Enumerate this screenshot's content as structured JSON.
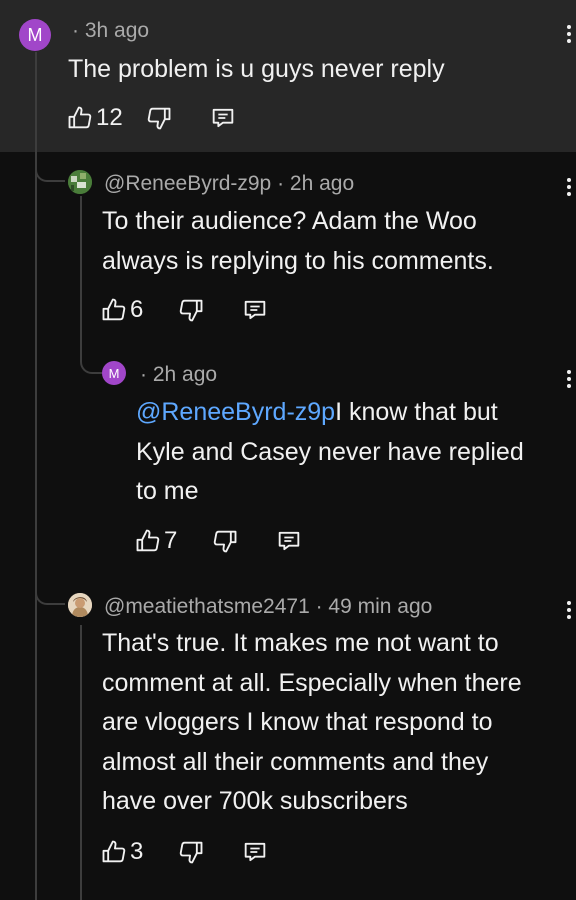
{
  "comments": [
    {
      "avatar_letter": "M",
      "avatar_color": "#a146c9",
      "meta": "· 3h ago",
      "lines": [
        "The problem is u guys never reply"
      ],
      "likes": "12"
    },
    {
      "avatar_icon": "pixel-art-avatar",
      "meta": "@ReneeByrd-z9p · 2h ago",
      "lines": [
        "To their audience? Adam the Woo",
        "always is replying to his comments."
      ],
      "likes": "6"
    },
    {
      "avatar_letter": "M",
      "avatar_color": "#a146c9",
      "meta": "· 2h ago",
      "mention": "@ReneeByrd-z9p",
      "lines": [
        "I know that but",
        "Kyle and Casey never have replied",
        "to me"
      ],
      "likes": "7"
    },
    {
      "avatar_icon": "photo-avatar",
      "meta": "@meatiethatsme2471 · 49 min ago",
      "lines": [
        "That's true. It makes me not want to",
        "comment at all. Especially when there",
        "are vloggers I know that respond to",
        "almost all their comments and they",
        "have over 700k subscribers"
      ],
      "likes": "3"
    }
  ],
  "icons": {
    "like": "thumbs-up-icon",
    "dislike": "thumbs-down-icon",
    "reply": "reply-comment-icon",
    "more": "more-vertical-icon"
  },
  "colors": {
    "highlight_bg": "#272727",
    "mention": "#5ea8ff",
    "meta": "#aaaaaa"
  }
}
